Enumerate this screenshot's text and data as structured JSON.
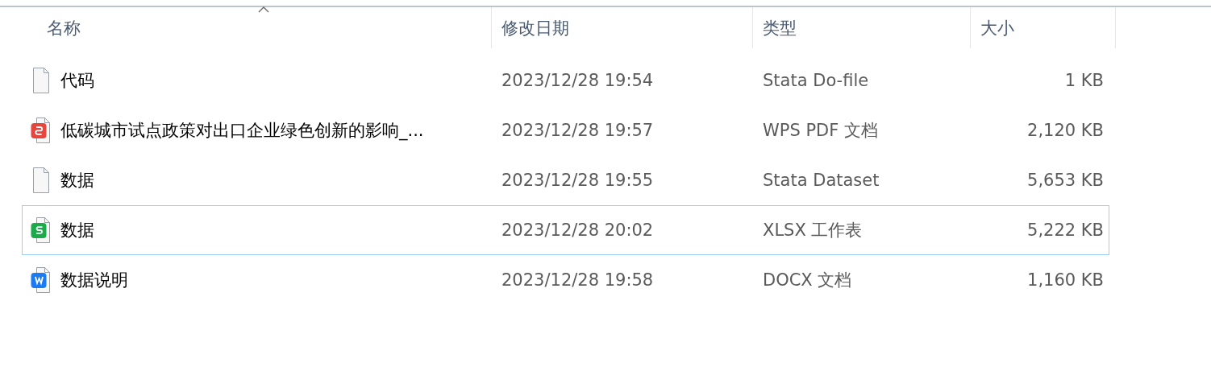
{
  "table": {
    "columns": [
      {
        "label": "名称",
        "sorted": true
      },
      {
        "label": "修改日期",
        "sorted": false
      },
      {
        "label": "类型",
        "sorted": false
      },
      {
        "label": "大小",
        "sorted": false
      }
    ],
    "rows": [
      {
        "kind": "blank",
        "name": "代码",
        "modified": "2023/12/28 19:54",
        "type": "Stata Do-file",
        "size": "1 KB",
        "focused": false
      },
      {
        "kind": "pdf",
        "name": "低碳城市试点政策对出口企业绿色创新的影响_...",
        "modified": "2023/12/28 19:57",
        "type": "WPS PDF 文档",
        "size": "2,120 KB",
        "focused": false
      },
      {
        "kind": "blank",
        "name": "数据",
        "modified": "2023/12/28 19:55",
        "type": "Stata Dataset",
        "size": "5,653 KB",
        "focused": false
      },
      {
        "kind": "xlsx",
        "name": "数据",
        "modified": "2023/12/28 20:02",
        "type": "XLSX 工作表",
        "size": "5,222 KB",
        "focused": true
      },
      {
        "kind": "docx",
        "name": "数据说明",
        "modified": "2023/12/28 19:58",
        "type": "DOCX 文档",
        "size": "1,160 KB",
        "focused": false
      }
    ]
  }
}
